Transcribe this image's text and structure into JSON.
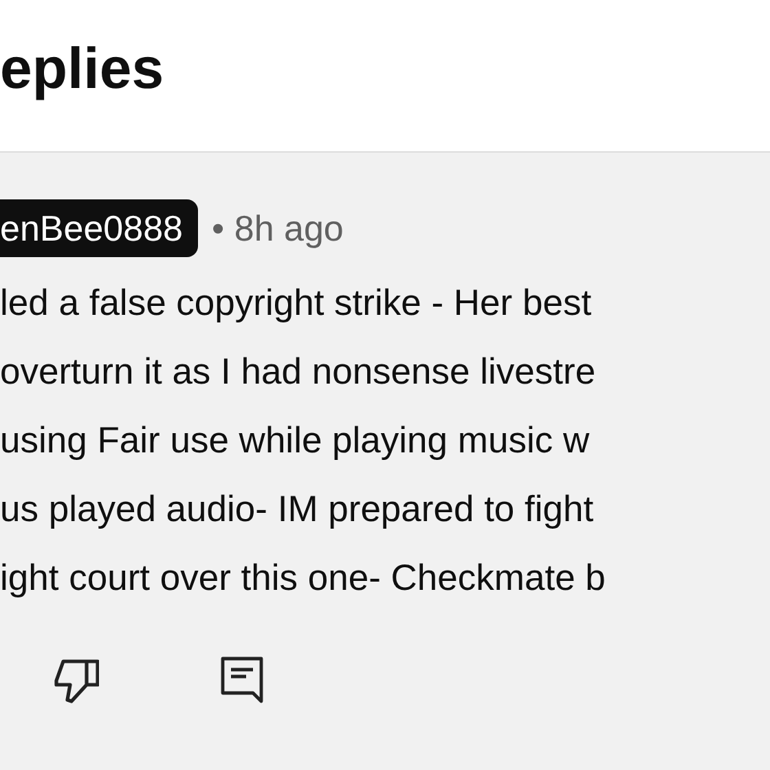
{
  "header": {
    "title": "eplies"
  },
  "comment": {
    "author": "enBee0888",
    "time": "• 8h ago",
    "lines": [
      "led a false copyright strike - Her best",
      "overturn it as I had nonsense livestre",
      "using Fair use while playing music w",
      "us played audio- IM prepared to fight",
      "ight court over this one- Checkmate b"
    ]
  }
}
